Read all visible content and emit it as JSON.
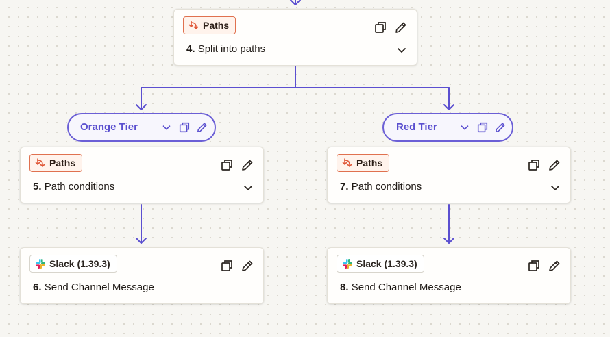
{
  "split_step": {
    "badge": "Paths",
    "number": "4.",
    "title": "Split into paths"
  },
  "branches": [
    {
      "name": "Orange Tier",
      "condition_step": {
        "badge": "Paths",
        "number": "5.",
        "title": "Path conditions"
      },
      "action_step": {
        "badge": "Slack (1.39.3)",
        "number": "6.",
        "title": "Send Channel Message"
      }
    },
    {
      "name": "Red Tier",
      "condition_step": {
        "badge": "Paths",
        "number": "7.",
        "title": "Path conditions"
      },
      "action_step": {
        "badge": "Slack (1.39.3)",
        "number": "8.",
        "title": "Send Channel Message"
      }
    }
  ],
  "colors": {
    "connector": "#5b4fd0",
    "paths_badge_border": "#e0714f",
    "pill_border": "#6b5fd6",
    "pill_text": "#5a4fcf",
    "canvas_background": "#f7f6f2"
  },
  "icons": {
    "paths": "split-arrows-icon",
    "slack": "slack-logo-icon",
    "copy": "duplicate-icon",
    "edit": "pencil-icon",
    "expand": "chevron-down-icon"
  }
}
